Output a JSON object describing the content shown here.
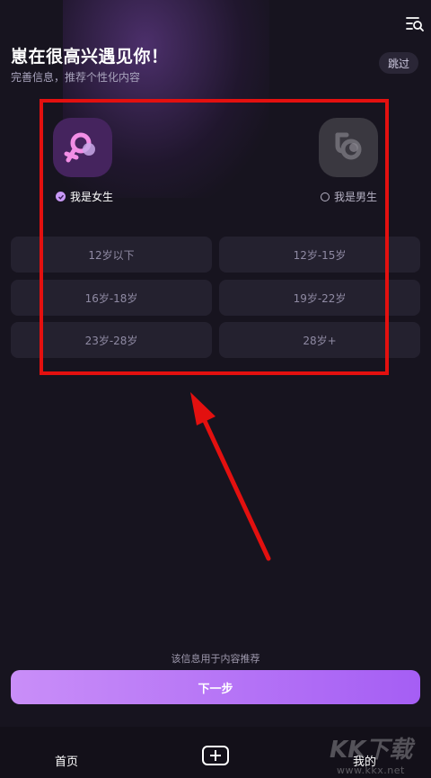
{
  "header": {
    "title": "崽在很高兴遇见你！",
    "subtitle": "完善信息，推荐个性化内容",
    "skip_label": "跳过",
    "menu_icon": "list-search-icon"
  },
  "gender": {
    "female_label": "我是女生",
    "male_label": "我是男生",
    "selected": "female",
    "female_icon": "female-symbol-icon",
    "male_icon": "male-symbol-icon"
  },
  "age_ranges": [
    {
      "label": "12岁以下"
    },
    {
      "label": "12岁-15岁"
    },
    {
      "label": "16岁-18岁"
    },
    {
      "label": "19岁-22岁"
    },
    {
      "label": "23岁-28岁"
    },
    {
      "label": "28岁+"
    }
  ],
  "footer": {
    "note": "该信息用于内容推荐",
    "next_label": "下一步"
  },
  "tabbar": {
    "home_label": "首页",
    "add_icon": "plus-icon",
    "mine_label": "我的"
  },
  "watermark": {
    "text": "KK下载",
    "url": "www.kkx.net"
  },
  "colors": {
    "background": "#17141f",
    "accent": "#a55ef4",
    "annotation": "#e3100f"
  }
}
